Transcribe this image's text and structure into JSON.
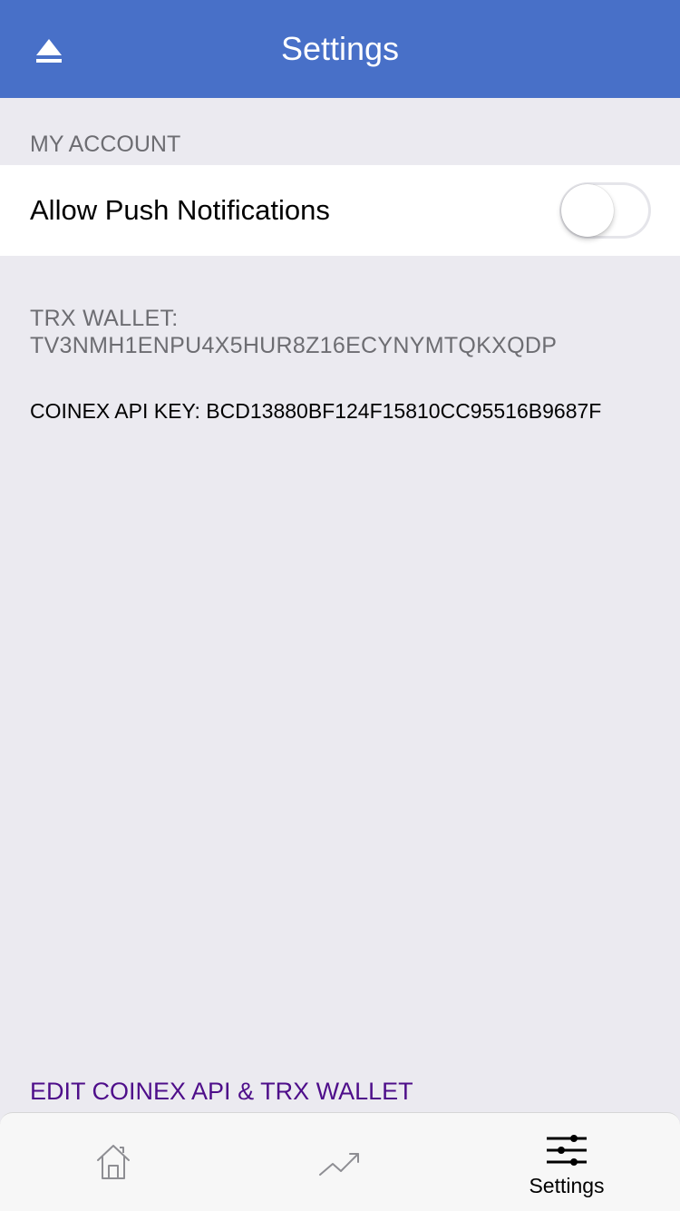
{
  "header": {
    "title": "Settings",
    "left_icon": "eject-icon"
  },
  "account": {
    "section_title": "MY ACCOUNT",
    "push_label": "Allow Push Notifications",
    "push_enabled": false
  },
  "wallet": {
    "label": "TRX WALLET:",
    "address": "TV3NMH1ENPU4X5HUR8Z16ECYNYMTQKXQDP"
  },
  "api": {
    "text": "COINEX API KEY: BCD13880BF124F15810CC95516B9687F"
  },
  "edit_link": "EDIT COINEX API & TRX WALLET",
  "tabbar": {
    "items": [
      {
        "icon": "home-icon",
        "label": ""
      },
      {
        "icon": "trend-up-icon",
        "label": ""
      },
      {
        "icon": "sliders-icon",
        "label": "Settings",
        "selected": true
      }
    ]
  },
  "colors": {
    "navbar": "#4870c8",
    "background": "#ebeaf0",
    "link": "#4e0e8a"
  }
}
